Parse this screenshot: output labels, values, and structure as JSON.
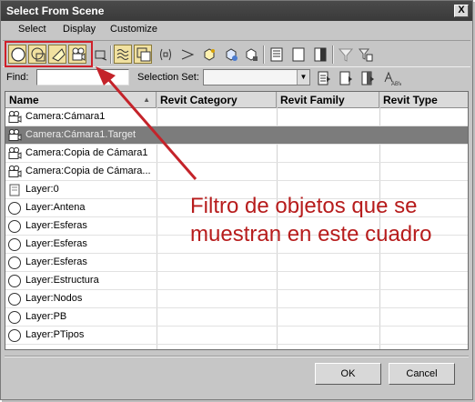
{
  "window": {
    "title": "Select From Scene",
    "close_label": "X"
  },
  "menu": [
    {
      "label": "Select"
    },
    {
      "label": "Display"
    },
    {
      "label": "Customize"
    }
  ],
  "toolbar": {
    "buttons": [
      {
        "icon": "geometry-filter-icon",
        "active": true
      },
      {
        "icon": "shapes-filter-icon",
        "active": true
      },
      {
        "icon": "lights-filter-icon",
        "active": true
      },
      {
        "icon": "cameras-filter-icon",
        "active": true
      },
      {
        "icon": "helpers-filter-icon",
        "active": false
      },
      {
        "icon": "spacewarps-filter-icon",
        "active": true
      },
      {
        "icon": "groups-filter-icon",
        "active": true
      },
      {
        "icon": "xrefs-filter-icon",
        "active": false
      },
      {
        "icon": "bones-filter-icon",
        "active": false
      },
      {
        "icon": "containers-filter-icon",
        "active": false
      },
      {
        "icon": "frozen-filter-icon",
        "active": false
      },
      {
        "icon": "hidden-filter-icon",
        "active": false
      },
      {
        "icon": "display-all-icon",
        "active": false
      },
      {
        "icon": "display-none-icon",
        "active": false
      },
      {
        "icon": "invert-display-icon",
        "active": false
      },
      {
        "icon": "filter-icon",
        "active": false
      },
      {
        "icon": "filter-options-icon",
        "active": false
      }
    ]
  },
  "find": {
    "label": "Find:",
    "value": ""
  },
  "selection_set": {
    "label": "Selection Set:",
    "value": ""
  },
  "columns": [
    {
      "label": "Name"
    },
    {
      "label": "Revit Category"
    },
    {
      "label": "Revit Family"
    },
    {
      "label": "Revit Type"
    }
  ],
  "rows": [
    {
      "name": "Camera:Cámara1",
      "icon": "camera-icon",
      "selected": false
    },
    {
      "name": "Camera:Cámara1.Target",
      "icon": "camera-icon",
      "selected": true
    },
    {
      "name": "Camera:Copia de Cámara1",
      "icon": "camera-icon",
      "selected": false
    },
    {
      "name": "Camera:Copia de Cámara...",
      "icon": "camera-icon",
      "selected": false
    },
    {
      "name": "Layer:0",
      "icon": "layer-icon",
      "selected": false
    },
    {
      "name": "Layer:Antena",
      "icon": "circle-icon",
      "selected": false
    },
    {
      "name": "Layer:Esferas",
      "icon": "circle-icon",
      "selected": false
    },
    {
      "name": "Layer:Esferas",
      "icon": "circle-icon",
      "selected": false
    },
    {
      "name": "Layer:Esferas",
      "icon": "circle-icon",
      "selected": false
    },
    {
      "name": "Layer:Estructura",
      "icon": "circle-icon",
      "selected": false
    },
    {
      "name": "Layer:Nodos",
      "icon": "circle-icon",
      "selected": false
    },
    {
      "name": "Layer:PB",
      "icon": "circle-icon",
      "selected": false
    },
    {
      "name": "Layer:PTipos",
      "icon": "circle-icon",
      "selected": false
    }
  ],
  "annotation": {
    "text": "Filtro de objetos que se muestran en este cuadro",
    "color": "#b71c1c"
  },
  "buttons": {
    "ok": "OK",
    "cancel": "Cancel"
  },
  "colors": {
    "highlight": "#d0202a",
    "selected_row": "#7c7c7c",
    "titlebar": "#3f3f3f"
  }
}
